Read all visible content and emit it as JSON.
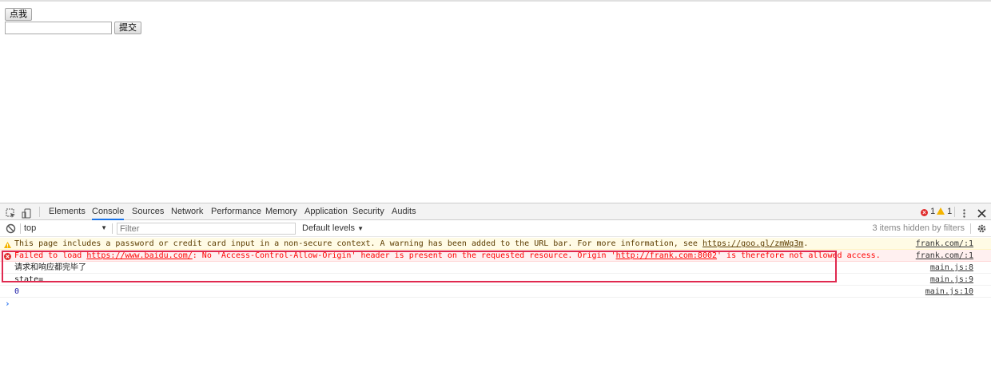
{
  "page": {
    "click_button": "点我",
    "input_value": "",
    "submit_button": "提交"
  },
  "devtools": {
    "tabs": [
      {
        "label": "Elements"
      },
      {
        "label": "Console",
        "active": true
      },
      {
        "label": "Sources"
      },
      {
        "label": "Network"
      },
      {
        "label": "Performance"
      },
      {
        "label": "Memory"
      },
      {
        "label": "Application"
      },
      {
        "label": "Security"
      },
      {
        "label": "Audits"
      }
    ],
    "error_count": "1",
    "warning_count": "1",
    "context": "top",
    "filter_placeholder": "Filter",
    "levels": "Default levels",
    "hidden_note": "3 items hidden by filters",
    "accent": "#1a73e8",
    "error_color": "#ff0000",
    "highlight_color": "#e0294f"
  },
  "console": {
    "warning": {
      "text_before": "This page includes a password or credit card input in a non-secure context. A warning has been added to the URL bar. For more information, see ",
      "link": "https://goo.gl/zmWq3m",
      "text_after": ".",
      "source": "frank.com/:1"
    },
    "error": {
      "text_a": "Failed to load ",
      "link_a": "https://www.baidu.com/",
      "text_b": ": No 'Access-Control-Allow-Origin' header is present on the requested resource. Origin '",
      "link_b": "http://frank.com:8002",
      "text_c": "' is therefore not allowed access.",
      "source": "frank.com/:1"
    },
    "log1": {
      "text": "请求和响应都完毕了",
      "source": "main.js:8"
    },
    "log2": {
      "text": "state=",
      "source": "main.js:9"
    },
    "log3": {
      "text": "0",
      "source": "main.js:10"
    },
    "prompt": "›"
  }
}
